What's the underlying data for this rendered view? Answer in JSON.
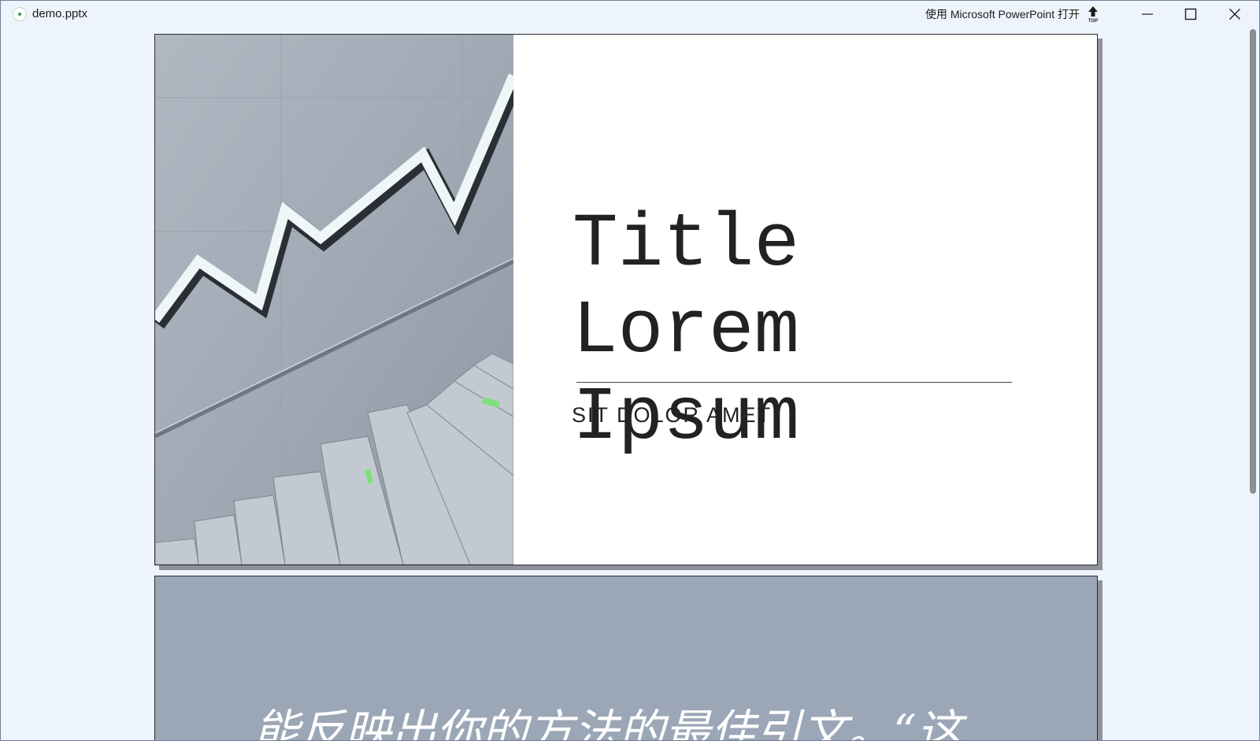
{
  "window": {
    "file_name": "demo.pptx",
    "open_with_label": "使用 Microsoft PowerPoint 打开",
    "icons": {
      "app": "document-app-icon",
      "pin": "pin-top-icon",
      "minimize": "minimize-icon",
      "maximize": "maximize-icon",
      "close": "close-icon"
    },
    "pin_label": "TOP"
  },
  "slides": [
    {
      "title": "Title Lorem Ipsum",
      "subtitle": "SIT DOLOR AMET",
      "image": "concrete-wall-stairs-rising-graph-photo"
    },
    {
      "quote": "能反映出你的方法的最佳引文。“这",
      "background": "#9ba7b6"
    }
  ],
  "colors": {
    "window_bg": "#eef4fc",
    "slide_border": "#2b2b2b",
    "slide_shadow": "#8f949b"
  }
}
